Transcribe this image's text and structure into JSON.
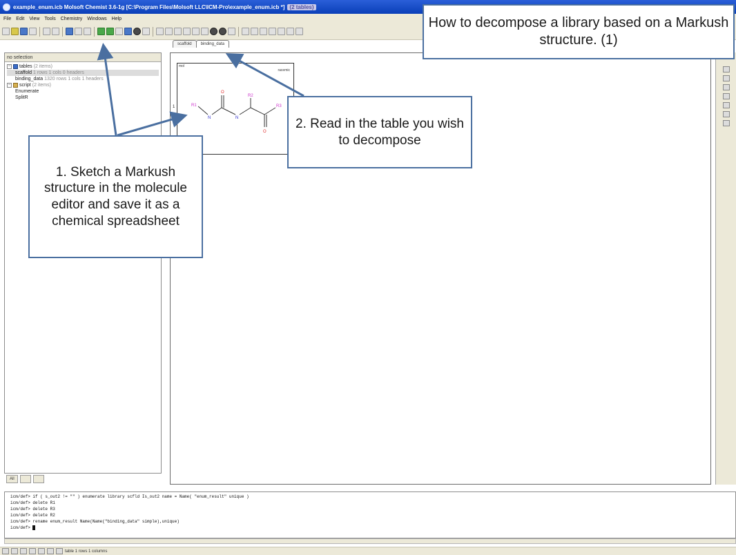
{
  "window": {
    "title": "example_enum.icb Molsoft Chemist 3.6-1g [C:\\Program Files\\Molsoft LLC\\ICM-Pro\\example_enum.icb *]",
    "title_badge": "(2 tables)"
  },
  "menu": [
    "File",
    "Edit",
    "View",
    "Tools",
    "Chemistry",
    "Windows",
    "Help"
  ],
  "left_panel": {
    "header": "no selection",
    "tree": {
      "tables_label": "tables",
      "tables_count": "(2 items)",
      "scaffold_label": "scaffold",
      "scaffold_meta": "1 rows 1 cols 0 headers",
      "binding_label": "binding_data",
      "binding_meta": "1320 rows 1 cols 1 headers",
      "script_label": "script",
      "script_count": "(2 items)",
      "enumerate_label": "Enumerate",
      "splitr_label": "SplitR"
    },
    "tabs": [
      "All"
    ]
  },
  "doc_tabs": [
    "scaffold",
    "binding_data"
  ],
  "molecule": {
    "column_header": "mol",
    "stereo_label": "racemic",
    "row_number": "1",
    "atom_labels": {
      "r1": "R1",
      "r2": "R2",
      "r3": "R3",
      "n1": "N",
      "n2": "N",
      "o1": "O",
      "o2": "O"
    }
  },
  "console": {
    "lines": [
      "icm/def> if ( s_out2 != \"\" ) enumerate library scfld Is_out2 name = Name( \"enum_result\" unique )",
      "icm/def> delete R1",
      "icm/def> delete R3",
      "icm/def> delete R2",
      "icm/def> rename enum_result Name(Name(\"binding_data\" simple),unique)",
      "icm/def> "
    ]
  },
  "statusbar": {
    "text": "table 1 rows 1 columns"
  },
  "callouts": {
    "title": "How to decompose a  library based on a Markush structure. (1)",
    "step1": "1. Sketch a Markush structure in the molecule editor and save it as a chemical spreadsheet",
    "step2": "2. Read in the table you wish to decompose"
  },
  "colors": {
    "callout_border": "#4a6fa0",
    "titlebar": "#0a3fb8",
    "r_group": "#cc33cc",
    "oxygen": "#e03030",
    "nitrogen": "#3333cc"
  }
}
